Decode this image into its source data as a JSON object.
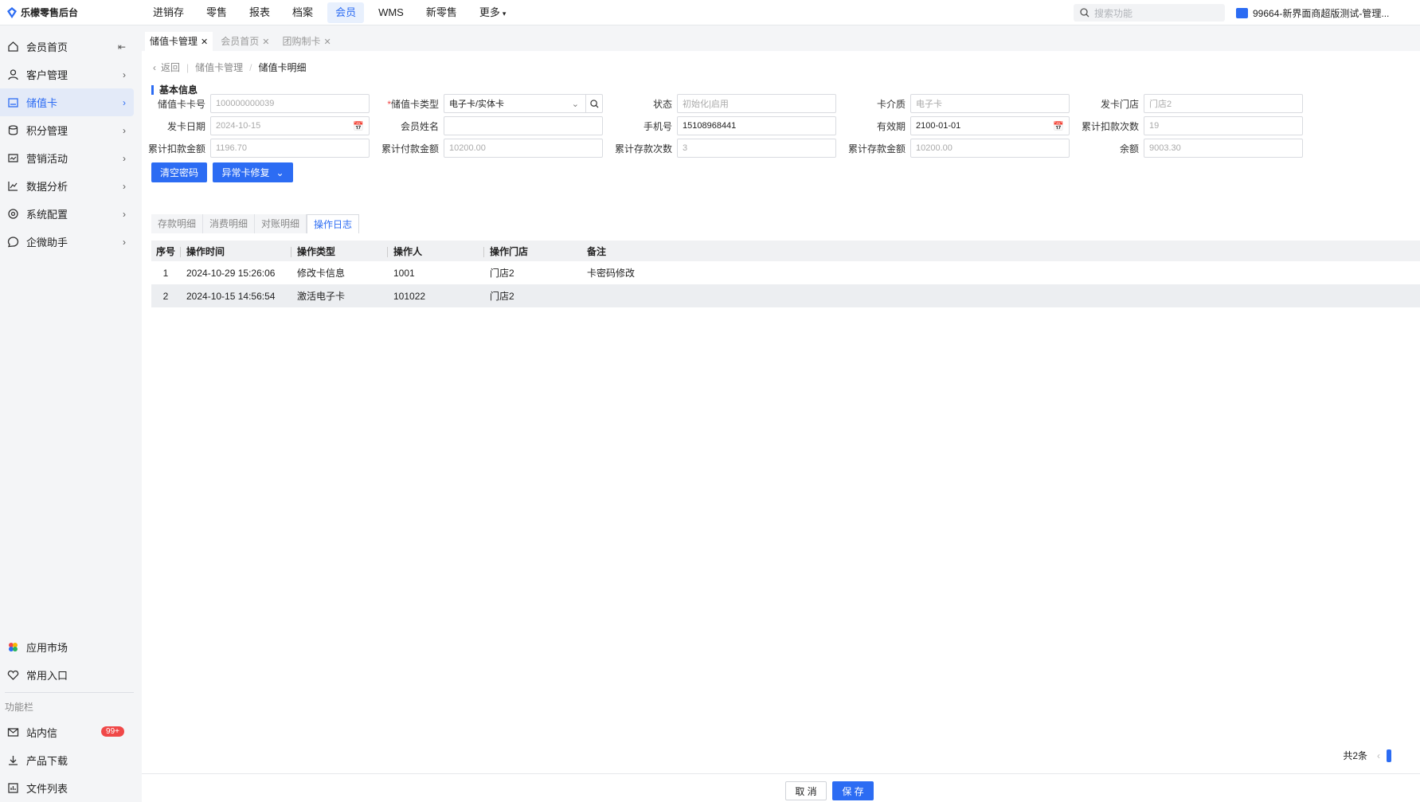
{
  "app": {
    "title": "乐檬零售后台"
  },
  "topnav": {
    "items": [
      "进销存",
      "零售",
      "报表",
      "档案",
      "会员",
      "WMS",
      "新零售",
      "更多"
    ],
    "active_index": 4,
    "search_placeholder": "搜索功能",
    "org_label": "99664-新界面商超版测试-管理..."
  },
  "sidebar": {
    "items": [
      {
        "label": "会员首页",
        "icon": "home-icon"
      },
      {
        "label": "客户管理",
        "icon": "user-icon"
      },
      {
        "label": "储值卡",
        "icon": "card-icon"
      },
      {
        "label": "积分管理",
        "icon": "coins-icon"
      },
      {
        "label": "营销活动",
        "icon": "promotion-icon"
      },
      {
        "label": "数据分析",
        "icon": "chart-icon"
      },
      {
        "label": "系统配置",
        "icon": "settings-icon"
      },
      {
        "label": "企微助手",
        "icon": "chat-icon"
      }
    ],
    "active_index": 2,
    "bottom": {
      "app_market": "应用市场",
      "favorites": "常用入口",
      "group_title": "功能栏",
      "messages": "站内信",
      "messages_badge": "99+",
      "downloads": "产品下载",
      "files": "文件列表"
    }
  },
  "tabs": [
    {
      "label": "储值卡管理",
      "active": true
    },
    {
      "label": "会员首页",
      "active": false
    },
    {
      "label": "团购制卡",
      "active": false
    }
  ],
  "breadcrumb": {
    "back": "返回",
    "parent": "储值卡管理",
    "current": "储值卡明细"
  },
  "section_title": "基本信息",
  "form": {
    "card_no": {
      "label": "储值卡卡号",
      "value": "100000000039"
    },
    "card_type": {
      "label": "储值卡类型",
      "value": "电子卡/实体卡"
    },
    "status": {
      "label": "状态",
      "value": "初始化|启用"
    },
    "medium": {
      "label": "卡介质",
      "value": "电子卡"
    },
    "issue_store": {
      "label": "发卡门店",
      "value": "门店2"
    },
    "issue_date": {
      "label": "发卡日期",
      "value": "2024-10-15"
    },
    "member_name": {
      "label": "会员姓名",
      "value": ""
    },
    "phone": {
      "label": "手机号",
      "value": "15108968441"
    },
    "expiry": {
      "label": "有效期",
      "value": "2100-01-01"
    },
    "deduct_times": {
      "label": "累计扣款次数",
      "value": "19"
    },
    "deduct_amount": {
      "label": "累计扣款金额",
      "value": "1196.70"
    },
    "paid_amount": {
      "label": "累计付款金额",
      "value": "10200.00"
    },
    "deposit_times": {
      "label": "累计存款次数",
      "value": "3"
    },
    "deposit_amount": {
      "label": "累计存款金额",
      "value": "10200.00"
    },
    "balance": {
      "label": "余额",
      "value": "9003.30"
    }
  },
  "actions": {
    "clear_password": "清空密码",
    "repair": "异常卡修复"
  },
  "subtabs": [
    "存款明细",
    "消费明细",
    "对账明细",
    "操作日志"
  ],
  "subtab_active_index": 3,
  "table": {
    "headers": [
      "序号",
      "操作时间",
      "操作类型",
      "操作人",
      "操作门店",
      "备注"
    ],
    "rows": [
      [
        "1",
        "2024-10-29 15:26:06",
        "修改卡信息",
        "1001",
        "门店2",
        "卡密码修改"
      ],
      [
        "2",
        "2024-10-15 14:56:54",
        "激活电子卡",
        "101022",
        "门店2",
        ""
      ]
    ]
  },
  "pager": {
    "total": "共2条"
  },
  "footer": {
    "cancel": "取 消",
    "save": "保 存"
  },
  "colors": {
    "accent": "#2c6cf3",
    "badge": "#f04848"
  }
}
